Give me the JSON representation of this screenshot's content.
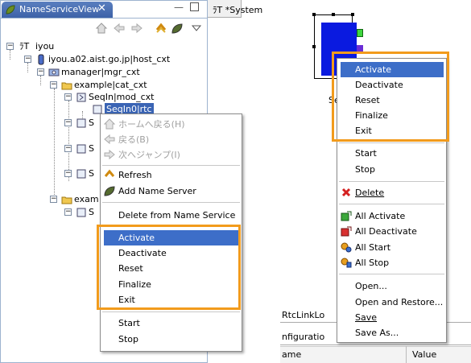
{
  "view": {
    "tab_title": "NameServiceView",
    "tab_close": "✕"
  },
  "editor": {
    "tab_title": "ﾗT *System"
  },
  "toolbar": {
    "icons": [
      "home-icon",
      "back-arrow-icon",
      "forward-arrow-icon",
      "refresh-icon",
      "add-name-server-icon",
      "view-menu-icon"
    ]
  },
  "tree": {
    "root": "iyou",
    "root_prefix": "ﾗT",
    "host": "iyou.a02.aist.go.jp|host_cxt",
    "manager": "manager|mgr_cxt",
    "category1": "example|cat_cxt",
    "module1": "SeqIn|mod_cxt",
    "component1": "SeqIn0|rtc",
    "hidden_s1": "S",
    "hidden_s2": "S",
    "hidden_s3": "S",
    "category2": "exam",
    "hidden_s4": "S"
  },
  "left_menu": {
    "items": [
      {
        "label": "ホームへ戻る(H)",
        "icon": "home-icon",
        "disabled": true
      },
      {
        "label": "戻る(B)",
        "icon": "back-arrow-icon",
        "disabled": true
      },
      {
        "label": "次へジャンプ(I)",
        "icon": "forward-arrow-icon",
        "disabled": true
      },
      {
        "label": "Refresh",
        "icon": "refresh-icon",
        "disabled": false
      },
      {
        "label": "Add Name Server",
        "icon": "add-name-server-icon",
        "disabled": false
      },
      {
        "label": "Delete from Name Service",
        "disabled": false
      },
      {
        "label": "Activate",
        "highlighted": true
      },
      {
        "label": "Deactivate"
      },
      {
        "label": "Reset"
      },
      {
        "label": "Finalize"
      },
      {
        "label": "Exit"
      },
      {
        "label": "Start"
      },
      {
        "label": "Stop"
      }
    ]
  },
  "right_menu": {
    "items": [
      {
        "label": "Activate",
        "highlighted": true
      },
      {
        "label": "Deactivate"
      },
      {
        "label": "Reset"
      },
      {
        "label": "Finalize"
      },
      {
        "label": "Exit"
      },
      {
        "label": "Start"
      },
      {
        "label": "Stop"
      },
      {
        "label": "Delete",
        "icon": "delete-x-icon",
        "mnemonic": "D"
      },
      {
        "label": "All Activate",
        "icon": "all-activate-icon"
      },
      {
        "label": "All Deactivate",
        "icon": "all-deactivate-icon"
      },
      {
        "label": "All Start",
        "icon": "all-start-icon"
      },
      {
        "label": "All Stop",
        "icon": "all-stop-icon"
      },
      {
        "label": "Open..."
      },
      {
        "label": "Open and Restore..."
      },
      {
        "label": "Save",
        "mnemonic": "S"
      },
      {
        "label": "Save As..."
      }
    ]
  },
  "diagram": {
    "component_label_fragment": "Se"
  },
  "lower_panels": {
    "tab1": "RtcLinkLo",
    "tab2": "nfiguratio",
    "col_name": "ame",
    "col_value": "Value"
  },
  "colors": {
    "highlight_border": "#f29b1c",
    "selection": "#3d6ec8",
    "component_fill": "#0a1ae0"
  }
}
